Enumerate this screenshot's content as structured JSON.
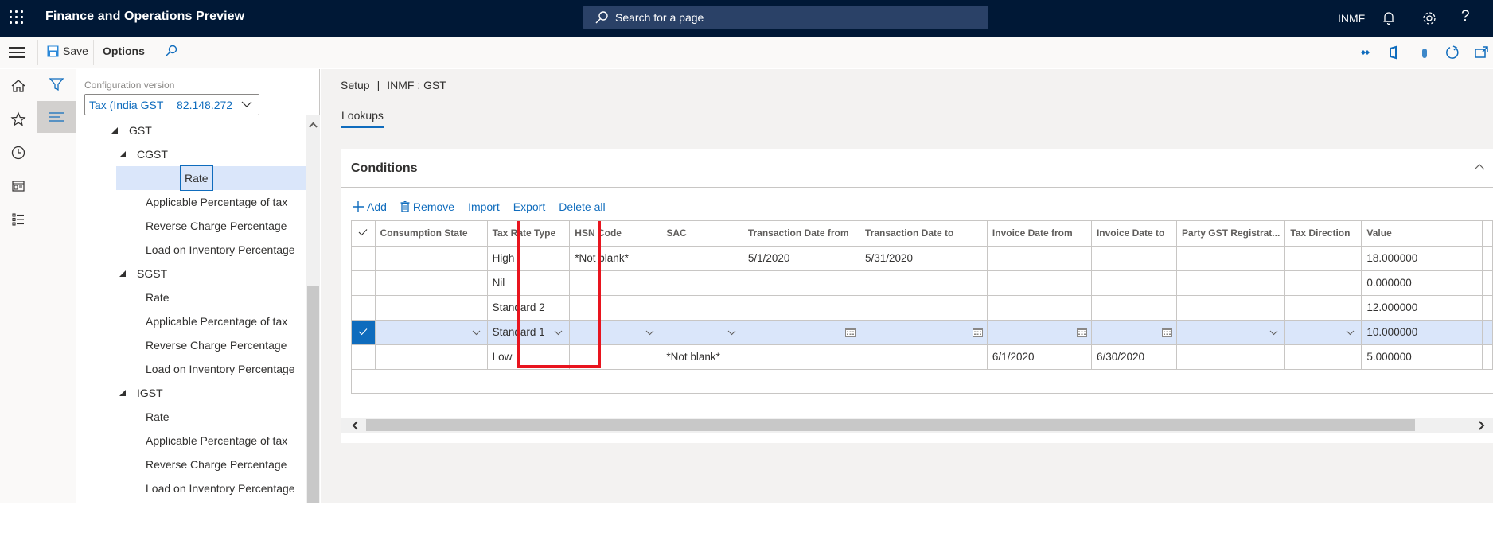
{
  "header": {
    "app_title": "Finance and Operations Preview",
    "search_placeholder": "Search for a page",
    "company": "INMF",
    "icons": [
      "waffle-icon",
      "search-icon",
      "bell-icon",
      "gear-icon",
      "help-icon"
    ]
  },
  "toolbar": {
    "save_label": "Save",
    "options_label": "Options",
    "notification_count": "0",
    "right_icons": [
      "power-apps-icon",
      "office-icon",
      "attachments-icon",
      "refresh-icon",
      "open-new-window-icon"
    ]
  },
  "nav_rail": {
    "items": [
      "hamburger-icon",
      "home-icon",
      "star-icon",
      "clock-icon",
      "workspace-icon",
      "list-icon"
    ]
  },
  "tree_panel": {
    "config_label": "Configuration version",
    "config_name": "Tax (India GST",
    "config_version": "82.148.272",
    "nodes": [
      {
        "label": "GST",
        "level": 0,
        "expanded": true
      },
      {
        "label": "CGST",
        "level": 1,
        "expanded": true
      },
      {
        "label": "Rate",
        "level": 2,
        "selected": true
      },
      {
        "label": "Applicable Percentage of tax",
        "level": 2
      },
      {
        "label": "Reverse Charge Percentage",
        "level": 2
      },
      {
        "label": "Load on Inventory Percentage",
        "level": 2
      },
      {
        "label": "SGST",
        "level": 1,
        "expanded": true
      },
      {
        "label": "Rate",
        "level": 2
      },
      {
        "label": "Applicable Percentage of tax",
        "level": 2
      },
      {
        "label": "Reverse Charge Percentage",
        "level": 2
      },
      {
        "label": "Load on Inventory Percentage",
        "level": 2
      },
      {
        "label": "IGST",
        "level": 1,
        "expanded": true
      },
      {
        "label": "Rate",
        "level": 2
      },
      {
        "label": "Applicable Percentage of tax",
        "level": 2
      },
      {
        "label": "Reverse Charge Percentage",
        "level": 2
      },
      {
        "label": "Load on Inventory Percentage",
        "level": 2
      }
    ]
  },
  "main": {
    "breadcrumb": {
      "part1": "Setup",
      "separator": "|",
      "part2": "INMF : GST"
    },
    "tab_label": "Lookups",
    "card_title": "Conditions",
    "actions": {
      "add": "Add",
      "remove": "Remove",
      "import": "Import",
      "export": "Export",
      "delete_all": "Delete all"
    },
    "columns": [
      "Consumption State",
      "Tax Rate Type",
      "HSN Code",
      "SAC",
      "Transaction Date from",
      "Transaction Date to",
      "Invoice Date from",
      "Invoice Date to",
      "Party GST Registrat...",
      "Tax Direction",
      "Value"
    ],
    "rows": [
      {
        "selected": false,
        "cells": [
          "",
          "High",
          "*Not blank*",
          "",
          "5/1/2020",
          "5/31/2020",
          "",
          "",
          "",
          "",
          "18.000000"
        ]
      },
      {
        "selected": false,
        "cells": [
          "",
          "Nil",
          "",
          "",
          "",
          "",
          "",
          "",
          "",
          "",
          "0.000000"
        ]
      },
      {
        "selected": false,
        "cells": [
          "",
          "Standard 2",
          "",
          "",
          "",
          "",
          "",
          "",
          "",
          "",
          "12.000000"
        ]
      },
      {
        "selected": true,
        "cells": [
          "",
          "Standard 1",
          "",
          "",
          "",
          "",
          "",
          "",
          "",
          "",
          "10.000000"
        ]
      },
      {
        "selected": false,
        "cells": [
          "",
          "Low",
          "",
          "*Not blank*",
          "",
          "",
          "6/1/2020",
          "6/30/2020",
          "",
          "",
          "5.000000"
        ]
      }
    ],
    "highlighted_column": "Tax Rate Type",
    "highlight_color": "#e8141e"
  },
  "colors": {
    "header_bg": "#001836",
    "accent": "#0f6cbd",
    "selection_bg": "#dae6fa"
  }
}
